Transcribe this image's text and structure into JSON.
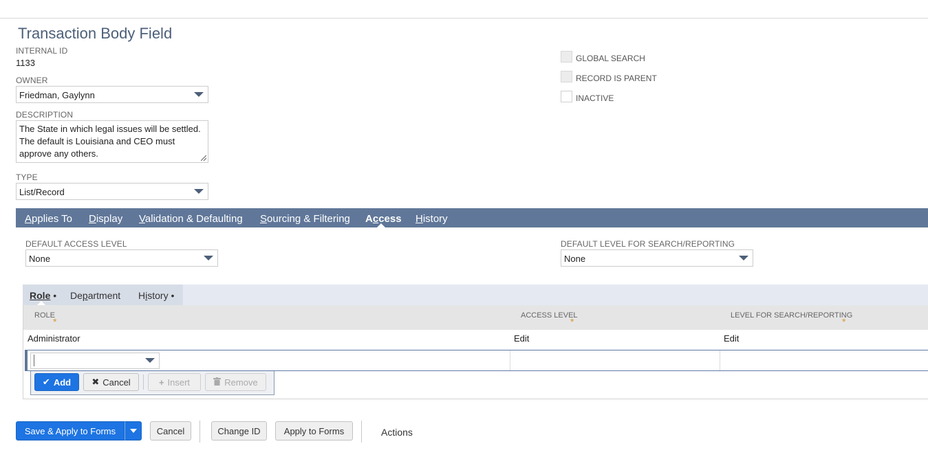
{
  "page": {
    "title": "Transaction Body Field"
  },
  "fields": {
    "internal_id_label": "INTERNAL ID",
    "internal_id_value": "1133",
    "owner_label": "OWNER",
    "owner_value": "Friedman, Gaylynn",
    "description_label": "DESCRIPTION",
    "description_value": "The State in which legal issues will be settled. The default is Louisiana and CEO must approve any others.",
    "type_label": "TYPE",
    "type_value": "List/Record"
  },
  "checkboxes": [
    {
      "label": "GLOBAL SEARCH",
      "checked": false,
      "disabled": true
    },
    {
      "label": "RECORD IS PARENT",
      "checked": false,
      "disabled": true
    },
    {
      "label": "INACTIVE",
      "checked": false,
      "disabled": false
    }
  ],
  "tabs": [
    {
      "first": "A",
      "rest": "pplies To",
      "active": false
    },
    {
      "first": "D",
      "rest": "isplay",
      "active": false
    },
    {
      "first": "V",
      "rest": "alidation & Defaulting",
      "active": false
    },
    {
      "first": "S",
      "rest": "ourcing & Filtering",
      "active": false
    },
    {
      "pre": "A",
      "first": "c",
      "rest": "cess",
      "active": true
    },
    {
      "first": "H",
      "rest": "istory",
      "active": false
    }
  ],
  "access": {
    "default_access_label": "DEFAULT ACCESS LEVEL",
    "default_access_value": "None",
    "default_search_label": "DEFAULT LEVEL FOR SEARCH/REPORTING",
    "default_search_value": "None"
  },
  "subtabs": [
    {
      "pre": "",
      "u": "R",
      "rest": "ole",
      "dot": " •",
      "active": true
    },
    {
      "pre": "De",
      "u": "p",
      "rest": "artment",
      "dot": "",
      "active": false
    },
    {
      "pre": "H",
      "u": "i",
      "rest": "story",
      "dot": " •",
      "active": false
    }
  ],
  "grid": {
    "columns": [
      "ROLE",
      "ACCESS LEVEL",
      "LEVEL FOR SEARCH/REPORTING"
    ],
    "required_mark": "*",
    "rows": [
      {
        "role": "Administrator",
        "access": "Edit",
        "search": "Edit"
      }
    ]
  },
  "machine_buttons": {
    "add": "Add",
    "cancel": "Cancel",
    "insert": "Insert",
    "remove": "Remove"
  },
  "footer": {
    "save_apply": "Save & Apply to Forms",
    "cancel": "Cancel",
    "change_id": "Change ID",
    "apply_forms": "Apply to Forms",
    "actions": "Actions"
  },
  "colors": {
    "tab_bar": "#607799",
    "primary_button": "#1d74e2",
    "required_star": "#d59a3a"
  }
}
